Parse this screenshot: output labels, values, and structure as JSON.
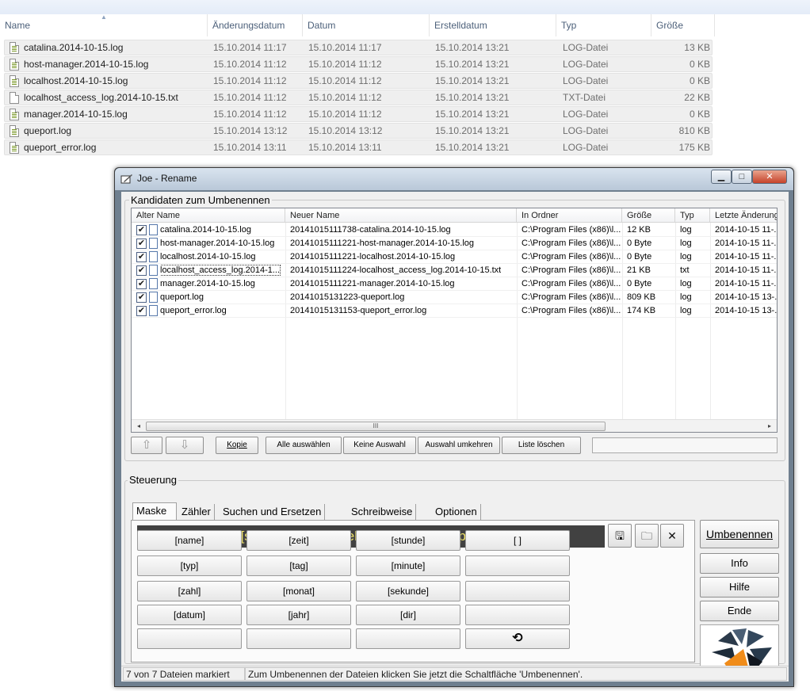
{
  "explorer": {
    "columns": [
      "Name",
      "Änderungsdatum",
      "Datum",
      "Erstelldatum",
      "Typ",
      "Größe"
    ],
    "files": [
      {
        "name": "catalina.2014-10-15.log",
        "modified": "15.10.2014 11:17",
        "date": "15.10.2014 11:17",
        "created": "15.10.2014 13:21",
        "type": "LOG-Datei",
        "size": "13 KB",
        "icon": "log-file-icon"
      },
      {
        "name": "host-manager.2014-10-15.log",
        "modified": "15.10.2014 11:12",
        "date": "15.10.2014 11:12",
        "created": "15.10.2014 13:21",
        "type": "LOG-Datei",
        "size": "0 KB",
        "icon": "log-file-icon"
      },
      {
        "name": "localhost.2014-10-15.log",
        "modified": "15.10.2014 11:12",
        "date": "15.10.2014 11:12",
        "created": "15.10.2014 13:21",
        "type": "LOG-Datei",
        "size": "0 KB",
        "icon": "log-file-icon"
      },
      {
        "name": "localhost_access_log.2014-10-15.txt",
        "modified": "15.10.2014 11:12",
        "date": "15.10.2014 11:12",
        "created": "15.10.2014 13:21",
        "type": "TXT-Datei",
        "size": "22 KB",
        "icon": "text-file-icon"
      },
      {
        "name": "manager.2014-10-15.log",
        "modified": "15.10.2014 11:12",
        "date": "15.10.2014 11:12",
        "created": "15.10.2014 13:21",
        "type": "LOG-Datei",
        "size": "0 KB",
        "icon": "log-file-icon"
      },
      {
        "name": "queport.log",
        "modified": "15.10.2014 13:12",
        "date": "15.10.2014 13:12",
        "created": "15.10.2014 13:21",
        "type": "LOG-Datei",
        "size": "810 KB",
        "icon": "log-file-icon"
      },
      {
        "name": "queport_error.log",
        "modified": "15.10.2014 13:11",
        "date": "15.10.2014 13:11",
        "created": "15.10.2014 13:21",
        "type": "LOG-Datei",
        "size": "175 KB",
        "icon": "log-file-icon"
      }
    ]
  },
  "dialog": {
    "title": "Joe - Rename",
    "window_buttons": {
      "minimize": "▁",
      "maximize": "□",
      "close": "✕"
    },
    "candidates": {
      "legend": "Kandidaten zum Umbenennen",
      "columns": [
        "Alter Name",
        "Neuer Name",
        "In Ordner",
        "Größe",
        "Typ",
        "Letzte Änderung"
      ],
      "rows": [
        {
          "checked": true,
          "old": "catalina.2014-10-15.log",
          "new": "20141015111738-catalina.2014-10-15.log",
          "folder": "C:\\Program Files (x86)\\l...",
          "size": "12 KB",
          "type": "log",
          "modified": "2014-10-15 11-..."
        },
        {
          "checked": true,
          "old": "host-manager.2014-10-15.log",
          "new": "20141015111221-host-manager.2014-10-15.log",
          "folder": "C:\\Program Files (x86)\\l...",
          "size": "0 Byte",
          "type": "log",
          "modified": "2014-10-15 11-..."
        },
        {
          "checked": true,
          "old": "localhost.2014-10-15.log",
          "new": "20141015111221-localhost.2014-10-15.log",
          "folder": "C:\\Program Files (x86)\\l...",
          "size": "0 Byte",
          "type": "log",
          "modified": "2014-10-15 11-..."
        },
        {
          "checked": true,
          "old": "localhost_access_log.2014-1...",
          "new": "20141015111224-localhost_access_log.2014-10-15.txt",
          "folder": "C:\\Program Files (x86)\\l...",
          "size": "21 KB",
          "type": "txt",
          "modified": "2014-10-15 11-..."
        },
        {
          "checked": true,
          "old": "manager.2014-10-15.log",
          "new": "20141015111221-manager.2014-10-15.log",
          "folder": "C:\\Program Files (x86)\\l...",
          "size": "0 Byte",
          "type": "log",
          "modified": "2014-10-15 11-..."
        },
        {
          "checked": true,
          "old": "queport.log",
          "new": "20141015131223-queport.log",
          "folder": "C:\\Program Files (x86)\\l...",
          "size": "809 KB",
          "type": "log",
          "modified": "2014-10-15 13-..."
        },
        {
          "checked": true,
          "old": "queport_error.log",
          "new": "20141015131153-queport_error.log",
          "folder": "C:\\Program Files (x86)\\l...",
          "size": "174 KB",
          "type": "log",
          "modified": "2014-10-15 13-..."
        }
      ],
      "checkmark": "✔",
      "scroll": {
        "left": "◂",
        "right": "▸",
        "grip": "III"
      }
    },
    "list_buttons": {
      "up": "⇧",
      "down": "⇩",
      "copy": "Kopie",
      "select_all": "Alle auswählen",
      "select_none": "Keine Auswahl",
      "invert": "Auswahl umkehren",
      "clear_list": "Liste löschen"
    },
    "control": {
      "legend": "Steuerung",
      "tabs": [
        "Maske",
        "Zähler",
        "Suchen und Ersetzen",
        "Schreibweise",
        "Optionen"
      ],
      "active_tab": "Maske",
      "mask_value": "[jahr][monat][tag][stunde][minute][sekunde]-[name].[typ]",
      "mask_icons": {
        "save": "🖫",
        "open": "🗀",
        "clear": "✕"
      },
      "tokens": [
        [
          "[name]",
          "[zeit]",
          "[stunde]",
          "[ ]"
        ],
        [
          "[typ]",
          "[tag]",
          "[minute]",
          ""
        ],
        [
          "[zahl]",
          "[monat]",
          "[sekunde]",
          ""
        ],
        [
          "[datum]",
          "[jahr]",
          "[dir]",
          ""
        ],
        [
          "",
          "",
          "",
          "⟲"
        ]
      ]
    },
    "side_buttons": {
      "rename": "Umbenennen",
      "info": "Info",
      "help": "Hilfe",
      "exit": "Ende"
    },
    "status": {
      "left": "7 von 7 Dateien markiert",
      "right": "Zum Umbenennen der Dateien klicken Sie jetzt die Schaltfläche 'Umbenennen'."
    }
  }
}
